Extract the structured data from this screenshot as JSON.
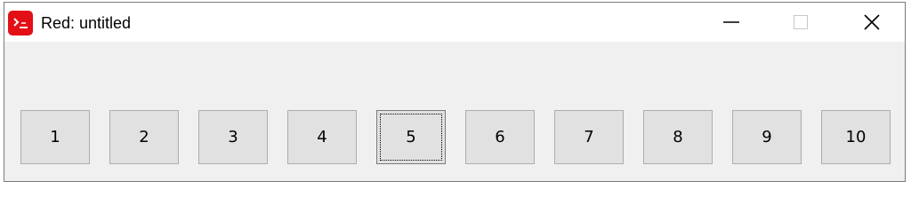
{
  "window": {
    "title": "Red: untitled",
    "app_icon": "red-language-icon",
    "controls": {
      "minimize": "minimize-icon",
      "maximize": "maximize-icon",
      "close": "close-icon"
    }
  },
  "buttons": [
    "1",
    "2",
    "3",
    "4",
    "5",
    "6",
    "7",
    "8",
    "9",
    "10"
  ],
  "focused_button": "5",
  "colors": {
    "app_icon_bg": "#e30f17",
    "client_bg": "#f0f0f0",
    "button_face": "#e1e1e1",
    "button_border": "#adadad"
  }
}
